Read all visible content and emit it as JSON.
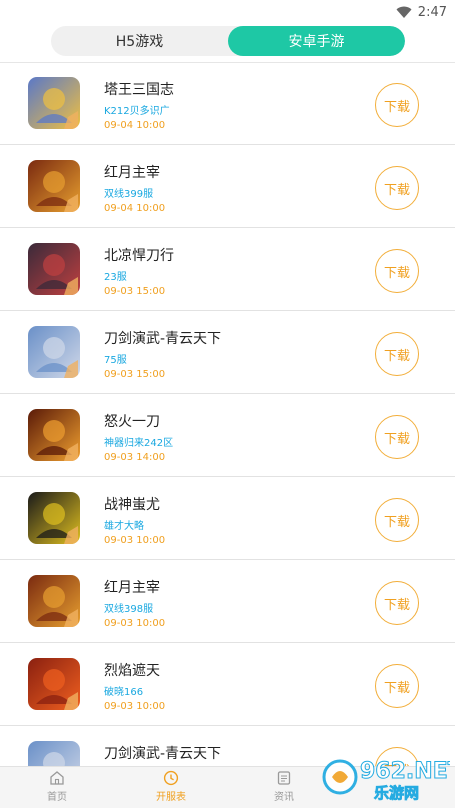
{
  "status": {
    "time": "2:47"
  },
  "tabs": [
    {
      "label": "H5游戏",
      "active": false
    },
    {
      "label": "安卓手游",
      "active": true
    }
  ],
  "games": [
    {
      "title": "塔王三国志",
      "sub": "K212贝多识广",
      "time": "09-04 10:00",
      "icon": "tawang-icon",
      "c1": "#5a78c8",
      "c2": "#f0c040"
    },
    {
      "title": "红月主宰",
      "sub": "双线399服",
      "time": "09-04 10:00",
      "icon": "hongyue-icon",
      "c1": "#7a2a10",
      "c2": "#e8a030"
    },
    {
      "title": "北凉悍刀行",
      "sub": "23服",
      "time": "09-03 15:00",
      "icon": "beiliang-icon",
      "c1": "#3a2a3a",
      "c2": "#c04040"
    },
    {
      "title": "刀剑演武-青云天下",
      "sub": "75服",
      "time": "09-03 15:00",
      "icon": "daojian-icon",
      "c1": "#6a90c8",
      "c2": "#d0d8e8"
    },
    {
      "title": "怒火一刀",
      "sub": "神器归来242区",
      "time": "09-03 14:00",
      "icon": "nuhuo-icon",
      "c1": "#5a1a08",
      "c2": "#f0a030"
    },
    {
      "title": "战神蚩尤",
      "sub": "雄才大略",
      "time": "09-03 10:00",
      "icon": "zhanshen-icon",
      "c1": "#1a1a1a",
      "c2": "#e0c020"
    },
    {
      "title": "红月主宰",
      "sub": "双线398服",
      "time": "09-03 10:00",
      "icon": "hongyue-icon",
      "c1": "#7a2a10",
      "c2": "#e8a030"
    },
    {
      "title": "烈焰遮天",
      "sub": "破晓166",
      "time": "09-03 10:00",
      "icon": "lieyan-icon",
      "c1": "#8a2010",
      "c2": "#f06020"
    },
    {
      "title": "刀剑演武-青云天下",
      "sub": "",
      "time": "",
      "icon": "daojian-icon",
      "c1": "#6a90c8",
      "c2": "#d0d8e8"
    }
  ],
  "download_label": "下载",
  "nav": [
    {
      "label": "首页",
      "icon": "home-icon",
      "active": false
    },
    {
      "label": "开服表",
      "icon": "clock-icon",
      "active": true
    },
    {
      "label": "资讯",
      "icon": "news-icon",
      "active": false
    }
  ],
  "watermark": {
    "brand": "962.NET",
    "sub": "乐游网"
  },
  "colors": {
    "accent": "#1ec8a5",
    "orange": "#f0a020",
    "blue": "#1aa8e0"
  }
}
